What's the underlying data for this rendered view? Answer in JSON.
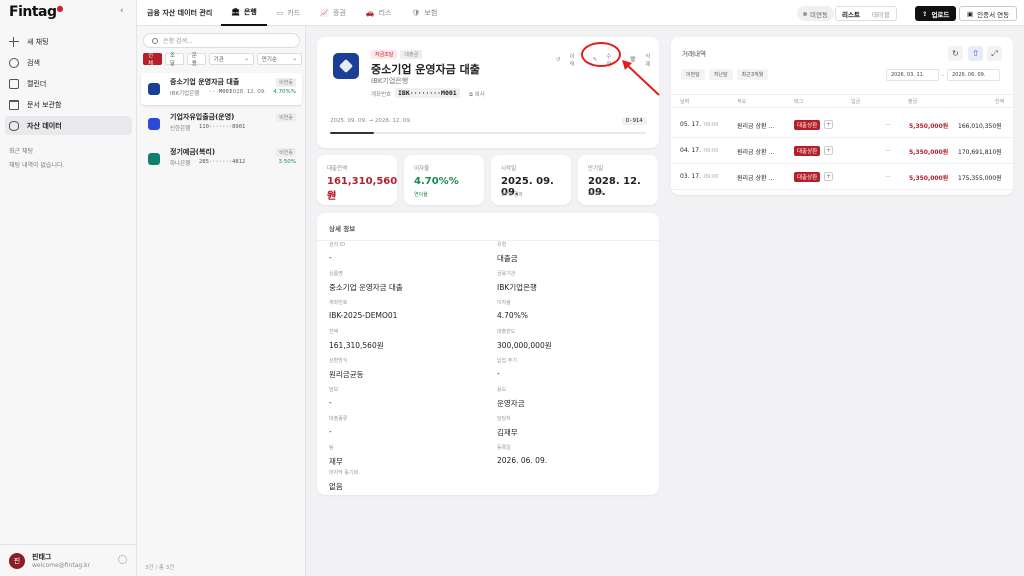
{
  "app": {
    "logo": "Fintag",
    "collapse": "‹"
  },
  "sidebar": {
    "items": [
      {
        "label": "새 채팅"
      },
      {
        "label": "검색"
      },
      {
        "label": "캘린더"
      },
      {
        "label": "문서 보관함"
      },
      {
        "label": "자산 데이터"
      }
    ],
    "recent_title": "최근 채팅",
    "recent_empty": "채팅 내역이 없습니다.",
    "user": {
      "avatar": "핀",
      "name": "핀태그",
      "email": "welcome@fintag.kr"
    }
  },
  "topbar": {
    "title": "금융 자산 데이터 관리",
    "tabs": [
      {
        "icon": "🏛",
        "label": "은행"
      },
      {
        "icon": "▭",
        "label": "카드"
      },
      {
        "icon": "📈",
        "label": "증권"
      },
      {
        "icon": "🚗",
        "label": "리스"
      },
      {
        "icon": "🛡",
        "label": "보험"
      }
    ],
    "unlinked": "미연동",
    "view_list": "리스트",
    "view_table": "테이블",
    "upload": "업로드",
    "cert": "인증서 연동"
  },
  "list": {
    "search_placeholder": "은행 검색...",
    "filters": [
      "전체",
      "조달",
      "운용"
    ],
    "select1": "기관",
    "select2": "만기순",
    "accounts": [
      {
        "name": "중소기업 운영자금 대출",
        "bank": "IBK기업은행",
        "number": "···M001",
        "tag": "비연동",
        "date": "2028. 12. 09.",
        "rate": "4.70%%",
        "color": "#1b3e96"
      },
      {
        "name": "기업자유입출금(운영)",
        "bank": "신한은행",
        "number": "110·······8901",
        "tag": "비연동",
        "date": "",
        "rate": "",
        "color": "#2b48d6"
      },
      {
        "name": "정기예금(복리)",
        "bank": "하나은행",
        "number": "285·······4812",
        "tag": "비연동",
        "date": "",
        "rate": "3.50%",
        "color": "#10806d"
      }
    ],
    "footer": "3건 / 총 3건"
  },
  "header": {
    "badge1": "자금조달",
    "badge2": "대출금",
    "name": "중소기업 운영자금 대출",
    "bank": "IBK기업은행",
    "account_label": "계좌번호",
    "account_no": "IBK········M001",
    "copy": "복사",
    "history": "이력",
    "edit": "수정",
    "delete": "삭제",
    "period": "2025. 09. 09. → 2028. 12. 09.",
    "dday": "D-914",
    "progress": 0.14
  },
  "stats": [
    {
      "label": "대출잔액",
      "value": "161,310,560원",
      "sub": "전체",
      "color": "#b41f29",
      "sub_color": "#b41f29"
    },
    {
      "label": "이자율",
      "value": "4.70%%",
      "sub": "연이율",
      "color": "#1a8a4a",
      "sub_color": "#1a8a4a"
    },
    {
      "label": "시작일",
      "value": "2025. 09. 09.",
      "sub": "23% 경과",
      "color": "#111",
      "sub_color": "#888"
    },
    {
      "label": "만기일",
      "value": "2028. 12. 09.",
      "sub": "D-914",
      "color": "#111",
      "sub_color": "#888"
    }
  ],
  "detail": {
    "title": "상세 정보",
    "fields": [
      {
        "label": "관리 ID",
        "value": "-"
      },
      {
        "label": "유형",
        "value": "대출금"
      },
      {
        "label": "상품명",
        "value": "중소기업 운영자금 대출"
      },
      {
        "label": "금융기관",
        "value": "IBK기업은행"
      },
      {
        "label": "계좌번호",
        "value": "IBK-2025-DEMO01"
      },
      {
        "label": "이자율",
        "value": "4.70%%"
      },
      {
        "label": "잔액",
        "value": "161,310,560원"
      },
      {
        "label": "대출한도",
        "value": "300,000,000원"
      },
      {
        "label": "상환방식",
        "value": "원리금균등"
      },
      {
        "label": "납입 주기",
        "value": "-"
      },
      {
        "label": "담보",
        "value": "-"
      },
      {
        "label": "용도",
        "value": "운영자금"
      },
      {
        "label": "대출종류",
        "value": "-"
      },
      {
        "label": "담당자",
        "value": "김재무"
      },
      {
        "label": "팀",
        "value": "재무"
      },
      {
        "label": "등록일",
        "value": "2026. 06. 09."
      },
      {
        "label": "마지막 동기화",
        "value": "없음"
      }
    ]
  },
  "transactions": {
    "title": "거래내역",
    "quick": [
      "이번달",
      "지난달",
      "최근3개월"
    ],
    "from": "2026. 03. 11.",
    "to": "2026. 06. 09.",
    "headers": [
      "날짜",
      "적요",
      "태그",
      "입금",
      "출금",
      "잔액"
    ],
    "rows": [
      {
        "date": "05. 17.",
        "time": "09:00",
        "memo": "원리금 상환 ...",
        "tag": "대출상환",
        "in": "—",
        "out": "5,350,000원",
        "bal": "166,010,350원"
      },
      {
        "date": "04. 17.",
        "time": "09:00",
        "memo": "원리금 상환 ...",
        "tag": "대출상환",
        "in": "—",
        "out": "5,350,000원",
        "bal": "170,691,810원"
      },
      {
        "date": "03. 17.",
        "time": "09:00",
        "memo": "원리금 상환 ...",
        "tag": "대출상환",
        "in": "—",
        "out": "5,350,000원",
        "bal": "175,355,000원"
      }
    ]
  }
}
